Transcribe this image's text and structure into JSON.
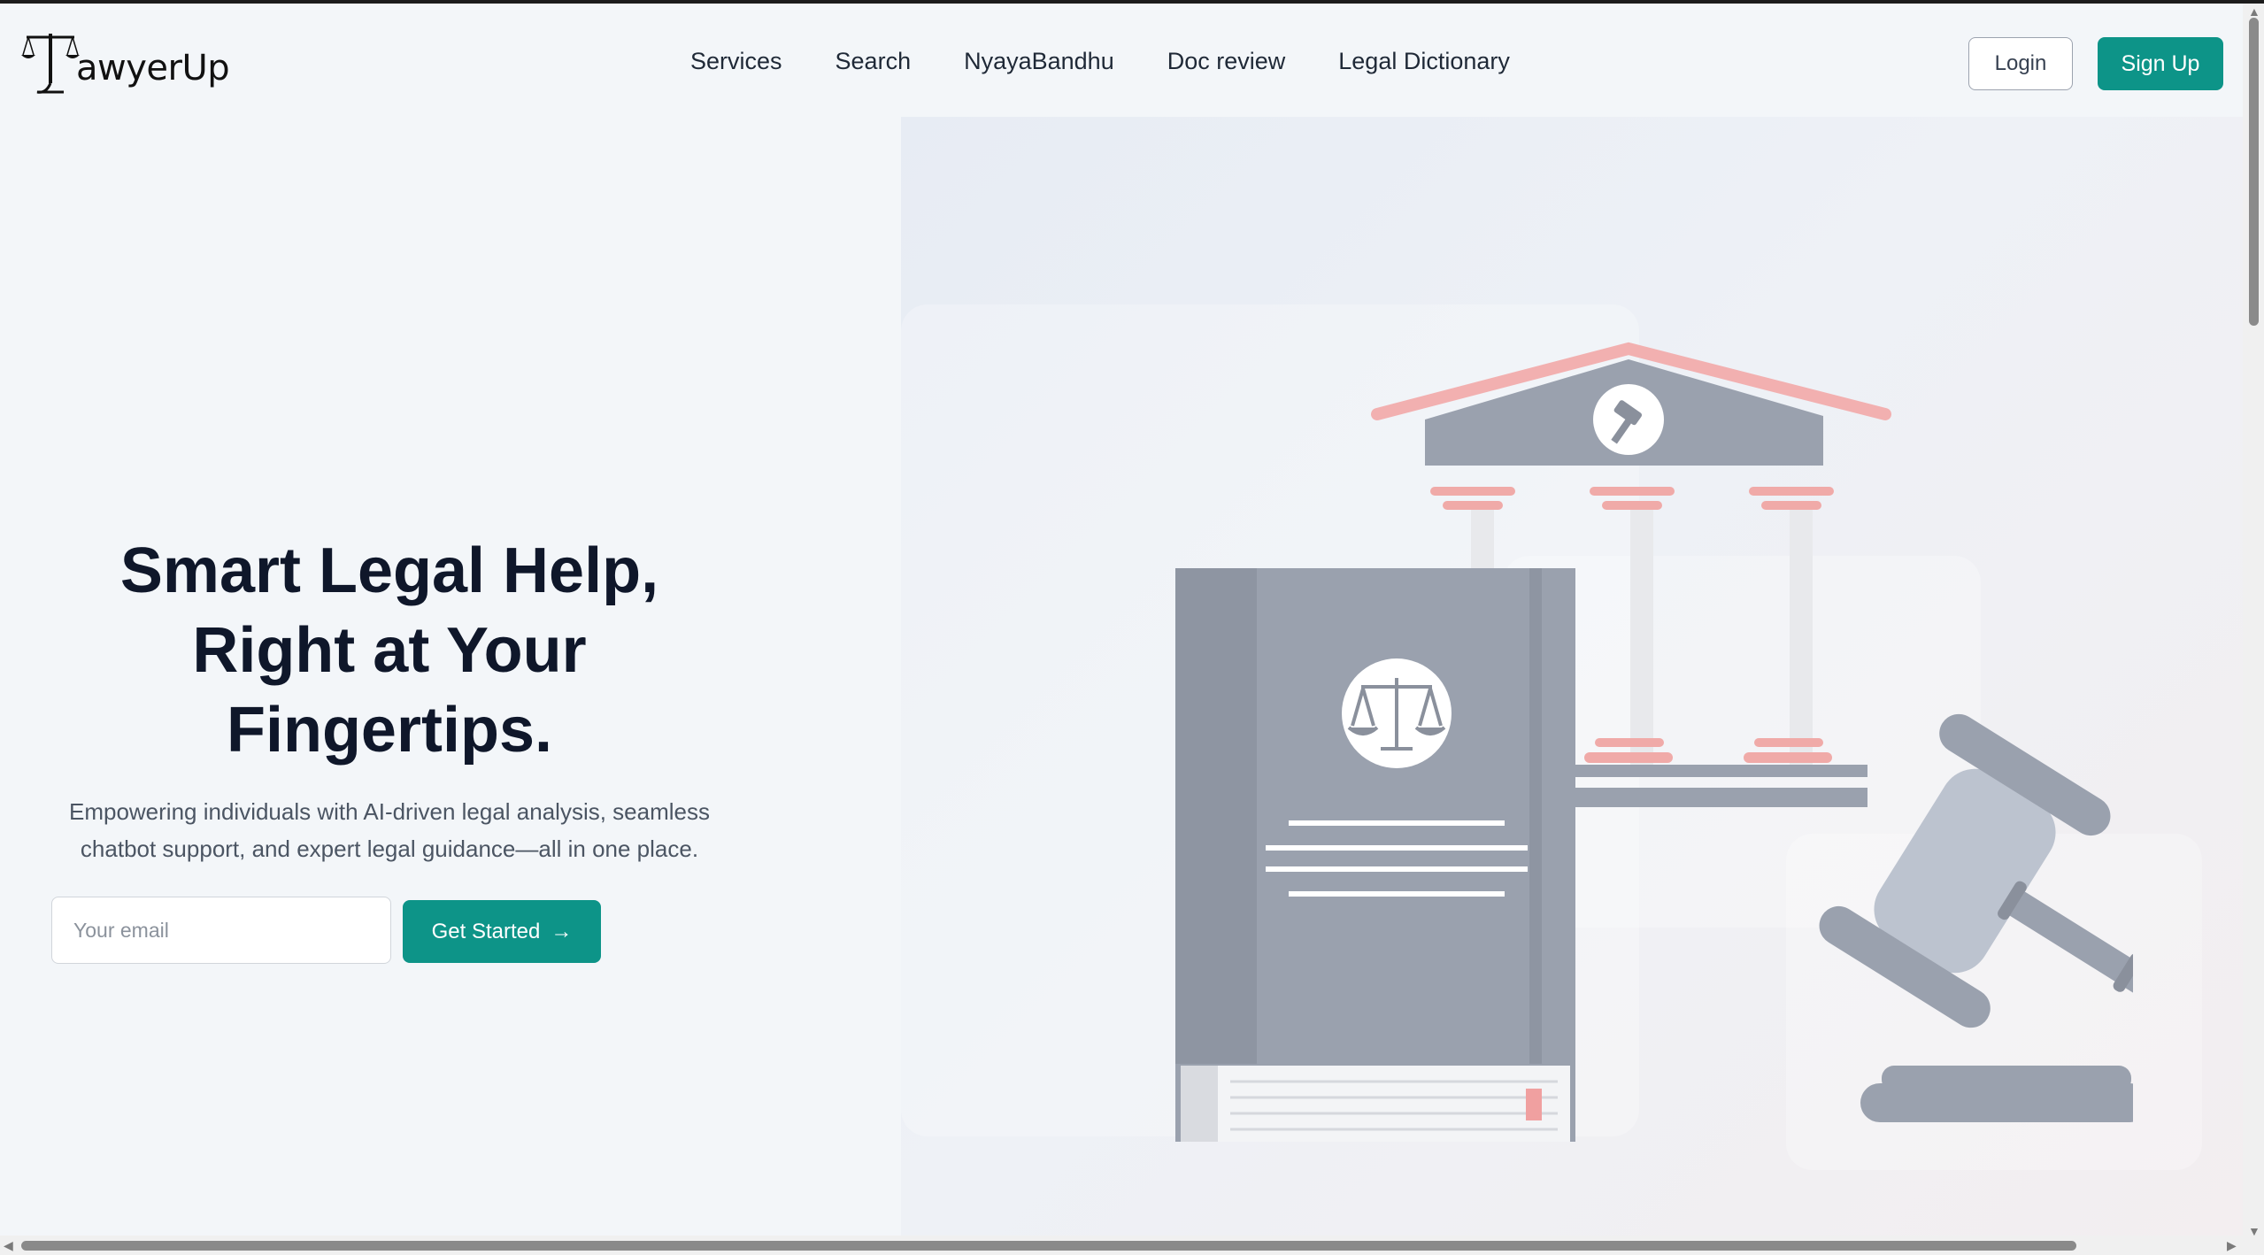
{
  "brand": {
    "name": "LawyerUp",
    "text_after_icon": "awyerUp"
  },
  "nav": {
    "items": [
      {
        "label": "Services"
      },
      {
        "label": "Search"
      },
      {
        "label": "NyayaBandhu"
      },
      {
        "label": "Doc review"
      },
      {
        "label": "Legal Dictionary"
      }
    ]
  },
  "auth": {
    "login_label": "Login",
    "signup_label": "Sign Up"
  },
  "hero": {
    "title_line1": "Smart Legal Help,",
    "title_line2": "Right at Your",
    "title_line3": "Fingertips.",
    "subtitle_line1": "Empowering individuals with AI-driven legal analysis, seamless",
    "subtitle_line2": "chatbot support, and expert legal guidance—all in one place.",
    "email_placeholder": "Your email",
    "cta_label": "Get Started",
    "cta_arrow": "→"
  },
  "illustration": {
    "name": "courthouse-law-book-gavel-illustration",
    "icons": [
      "scales-of-justice-icon",
      "gavel-icon",
      "courthouse-icon"
    ]
  },
  "colors": {
    "accent": "#0d9488",
    "text_dark": "#0f172a",
    "illus_gray": "#9ca3af",
    "illus_pink": "#f4a7a7"
  }
}
